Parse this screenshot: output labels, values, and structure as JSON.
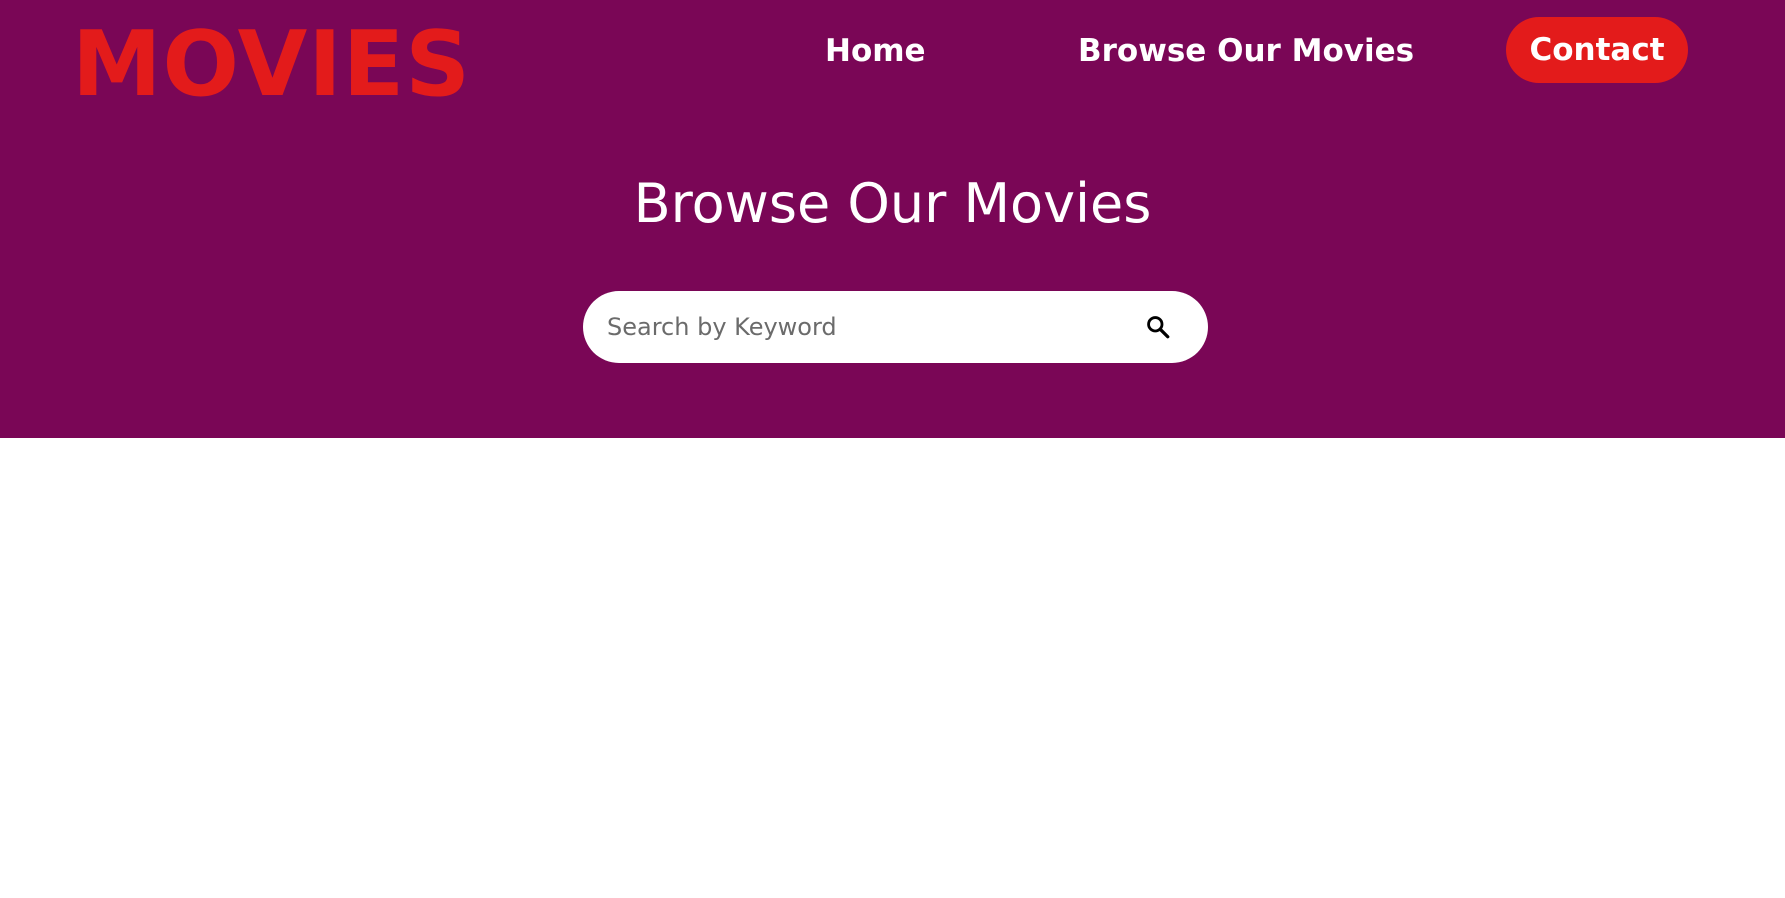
{
  "header": {
    "logo": "MOVIES",
    "nav": {
      "home": "Home",
      "browse": "Browse Our Movies",
      "contact": "Contact"
    }
  },
  "hero": {
    "title": "Browse Our Movies",
    "search": {
      "placeholder": "Search by Keyword",
      "value": "",
      "icon": "search-icon"
    }
  },
  "colors": {
    "hero_background": "#7a0656",
    "accent": "#e31b1b",
    "text_light": "#ffffff",
    "page_background": "#ffffff"
  }
}
